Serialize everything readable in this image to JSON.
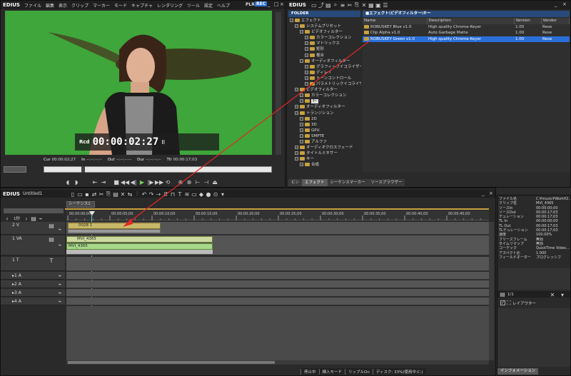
{
  "player": {
    "app_name": "EDIUS",
    "menu": [
      "ファイル",
      "編集",
      "表示",
      "クリップ",
      "マーカー",
      "モード",
      "キャプチャ",
      "レンダリング",
      "ツール",
      "設定",
      "ヘルプ"
    ],
    "mode_plr": "PLR",
    "mode_rec": "REC",
    "rcd_label": "Rcd",
    "timecode": "00:00:02:27",
    "timecode_suffix": "II",
    "cur_label": "Cur",
    "cur_value": "00:00:02;27",
    "in_label": "In",
    "in_value": "--:--:--:--",
    "out_label": "Out",
    "out_value": "--:--:--:--",
    "dur_label": "Dur",
    "dur_value": "--:--:--:--",
    "ttl_label": "Ttl",
    "ttl_value": "00:00:17;03"
  },
  "effect": {
    "app_name": "EDIUS",
    "folder_header": "FOLDER",
    "list_header": "■エフェクト\\ビデオフィルター\\キー",
    "tree": [
      {
        "label": "エフェクト",
        "indent": 0
      },
      {
        "label": "システムプリセット",
        "indent": 1
      },
      {
        "label": "ビデオフィルター",
        "indent": 2
      },
      {
        "label": "カラーコレクション",
        "indent": 3
      },
      {
        "label": "マトリックス",
        "indent": 3
      },
      {
        "label": "矩形",
        "indent": 3
      },
      {
        "label": "複合",
        "indent": 3
      },
      {
        "label": "オーディオフィルター",
        "indent": 2
      },
      {
        "label": "グラフィックイコライザー",
        "indent": 3
      },
      {
        "label": "ディレイ",
        "indent": 3
      },
      {
        "label": "トーンコントロール",
        "indent": 3
      },
      {
        "label": "パラメトリックイコライザ",
        "indent": 3
      },
      {
        "label": "ビデオフィルター",
        "indent": 1
      },
      {
        "label": "カラーコレクション",
        "indent": 2
      },
      {
        "label": "ｷｰ",
        "indent": 2,
        "selected": true
      },
      {
        "label": "オーディオフィルター",
        "indent": 1
      },
      {
        "label": "トランジション",
        "indent": 1
      },
      {
        "label": "2D",
        "indent": 2
      },
      {
        "label": "3D",
        "indent": 2
      },
      {
        "label": "GPU",
        "indent": 2
      },
      {
        "label": "SMPTE",
        "indent": 2
      },
      {
        "label": "アルファ",
        "indent": 2
      },
      {
        "label": "オーディオクロスフェード",
        "indent": 1
      },
      {
        "label": "タイトルミキサー",
        "indent": 1
      },
      {
        "label": "キー",
        "indent": 1
      },
      {
        "label": "合成",
        "indent": 2
      }
    ],
    "columns": [
      "Name",
      "Description",
      "Version",
      "Vendor"
    ],
    "rows": [
      {
        "name": "ROBUSKEY Blue v1.0",
        "description": "High quality Chroma-Keyer",
        "version": "1.00",
        "vendor": "Rese"
      },
      {
        "name": "Clip Alpha v1.0",
        "description": "Auto Garbage Matte",
        "version": "1.00",
        "vendor": "Rese"
      },
      {
        "name": "ROBUSKEY Green v1.0",
        "description": "High quality Chroma-Keyer",
        "version": "1.00",
        "vendor": "Rese"
      }
    ],
    "tabs": [
      "ビン",
      "エフェクト",
      "シーケンスマーカー",
      "ソースブラウザー"
    ]
  },
  "timeline": {
    "app_name": "EDIUS",
    "project": "Untitled1",
    "sequence_tab": "シーケンス1",
    "ratio": "1秒",
    "ruler": [
      "00:00:00;00",
      "00:00:05;00",
      "00:00:10;00",
      "00:00:15;00",
      "00:00:20;00",
      "00:00:25;00",
      "00:00:30;00",
      "00:00:35;00",
      "00:00:40;00",
      "00:00:45;00"
    ],
    "tracks": [
      {
        "label": "2 V"
      },
      {
        "label": "1 VA"
      },
      {
        "label": "1 T"
      },
      {
        "label": "▸1 A"
      },
      {
        "label": "▸2 A"
      },
      {
        "label": "▸3 A"
      },
      {
        "label": "▸4 A"
      }
    ],
    "clip_2v": "0028 1",
    "clip_1va_video": "MVI_4365",
    "clip_1va_audio": "MVI_4365",
    "status": [
      "停止中",
      "挿入モード",
      "リップルOn",
      "ディスク: 33%(使用中:C:)"
    ]
  },
  "info": {
    "rows": [
      [
        "ファイル名",
        "C:¥music¥Work¥2..."
      ],
      [
        "クリップ名",
        "MVI_4365"
      ],
      [
        "ソースIn",
        "00:00:00;00"
      ],
      [
        "ソースOut",
        "00:00:17;03"
      ],
      [
        "デュレーション",
        "00:00:17;03"
      ],
      [
        "TL In",
        "00:00:00;00"
      ],
      [
        "TL Out",
        "00:00:17;03"
      ],
      [
        "TLデュレーション",
        "00:00:17;03"
      ],
      [
        "速度",
        "100.00%"
      ],
      [
        "フリーズフレーム",
        "無効"
      ],
      [
        "タイムリマップ",
        "無効"
      ],
      [
        "コーデック",
        "QuickTime Video..."
      ],
      [
        "アスペクト比",
        "1.000"
      ],
      [
        "フィールドオーダー",
        "プログレッシブ"
      ]
    ],
    "layer_count": "1/1",
    "layer_item": "レイアウター",
    "tab": "インフォメーション"
  }
}
